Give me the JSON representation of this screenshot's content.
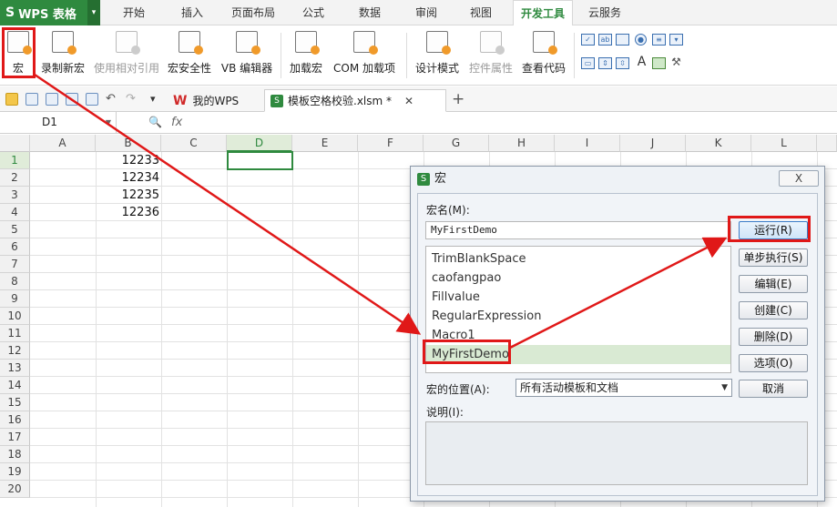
{
  "app": {
    "title": "WPS 表格"
  },
  "menu": {
    "tabs": [
      "开始",
      "插入",
      "页面布局",
      "公式",
      "数据",
      "审阅",
      "视图",
      "开发工具",
      "云服务"
    ],
    "active": "开发工具"
  },
  "ribbon": {
    "macro": "宏",
    "record": "录制新宏",
    "relative": "使用相对引用",
    "security": "宏安全性",
    "vb_editor": "VB 编辑器",
    "load_macro": "加载宏",
    "com_addin": "COM 加载项",
    "design_mode": "设计模式",
    "control_props": "控件属性",
    "view_code": "查看代码"
  },
  "doc_tabs": [
    {
      "label": "我的WPS"
    },
    {
      "label": "模板空格校验.xlsm *"
    }
  ],
  "formula_bar": {
    "cell_ref": "D1",
    "fx": "fx"
  },
  "sheet": {
    "columns": [
      "A",
      "B",
      "C",
      "D",
      "E",
      "F",
      "G",
      "H",
      "I",
      "J",
      "K",
      "L"
    ],
    "rows": [
      "1",
      "2",
      "3",
      "4",
      "5",
      "6",
      "7",
      "8",
      "9",
      "10",
      "11",
      "12",
      "13",
      "14",
      "15",
      "16",
      "17",
      "18",
      "19",
      "20"
    ],
    "b_values": [
      "12233",
      "12234",
      "12235",
      "12236"
    ]
  },
  "dialog": {
    "title": "宏",
    "close": "X",
    "name_label": "宏名(M):",
    "name_value": "MyFirstDemo",
    "macros": [
      "TrimBlankSpace",
      "caofangpao",
      "Fillvalue",
      "RegularExpression",
      "Macro1",
      "MyFirstDemo"
    ],
    "selected_macro": "MyFirstDemo",
    "buttons": {
      "run": "运行(R)",
      "step": "单步执行(S)",
      "edit": "编辑(E)",
      "create": "创建(C)",
      "delete": "删除(D)",
      "options": "选项(O)",
      "cancel": "取消"
    },
    "location_label": "宏的位置(A):",
    "location_value": "所有活动模板和文档",
    "desc_label": "说明(I):"
  },
  "colors": {
    "accent": "#2f8a3f",
    "annotation": "#e01818"
  }
}
